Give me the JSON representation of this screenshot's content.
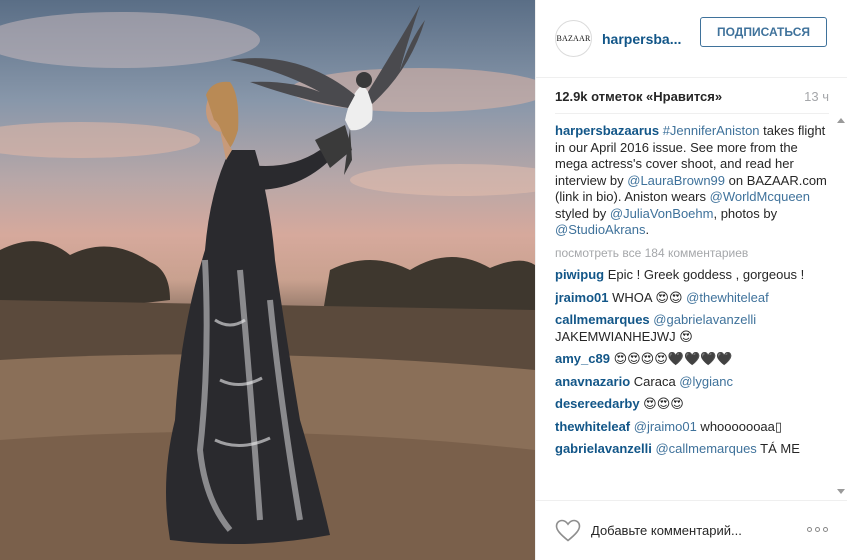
{
  "post": {
    "photo_alt": "",
    "header": {
      "avatar_text": "BAZAAR",
      "username": "harpersba...",
      "follow_label": "ПОДПИСАТЬСЯ"
    },
    "likes_label": "12.9k отметок «Нравится»",
    "time_ago": "13 ч",
    "caption": {
      "user": "harpersbazaarus",
      "hashtag": "#JenniferAniston",
      "text_1": " takes flight in our April 2016 issue. See more from the mega actress's cover shoot, and read her interview by ",
      "mention_1": "@LauraBrown99",
      "text_2": " on BAZAAR.com (link in bio). Aniston wears ",
      "mention_2": "@WorldMcqueen",
      "text_3": " styled by ",
      "mention_3": "@JuliaVonBoehm",
      "text_4": ", photos by ",
      "mention_4": "@StudioAkrans",
      "text_5": "."
    },
    "view_all_label": "посмотреть все 184 комментариев",
    "comments": [
      {
        "user": "piwipug",
        "text": " Epic ! Greek goddess , gorgeous !",
        "mention": "",
        "tail": ""
      },
      {
        "user": "jraimo01",
        "text": " WHOA 😍😍 ",
        "mention": "@thewhiteleaf",
        "tail": ""
      },
      {
        "user": "callmemarques",
        "text": " ",
        "mention": "@gabrielavanzelli",
        "tail": " JAKEMWIANHEJWJ 😍"
      },
      {
        "user": "amy_c89",
        "text": " 😍😍😍😍🖤🖤🖤🖤",
        "mention": "",
        "tail": ""
      },
      {
        "user": "anavnazario",
        "text": " Caraca ",
        "mention": "@lygianc",
        "tail": ""
      },
      {
        "user": "desereedarby",
        "text": " 😍😍😍",
        "mention": "",
        "tail": ""
      },
      {
        "user": "thewhiteleaf",
        "text": " ",
        "mention": "@jraimo01",
        "tail": " whooooooaa▯"
      },
      {
        "user": "gabrielavanzelli",
        "text": " ",
        "mention": "@callmemarques",
        "tail": " TÁ ME"
      }
    ],
    "footer": {
      "heart_icon": "heart-outline-icon",
      "comment_placeholder": "Добавьте комментарий...",
      "more_icon": "more-options-icon"
    }
  },
  "colors": {
    "username_blue": "#125688",
    "link_blue": "#3f729b",
    "muted_gray": "#a5a7aa"
  }
}
